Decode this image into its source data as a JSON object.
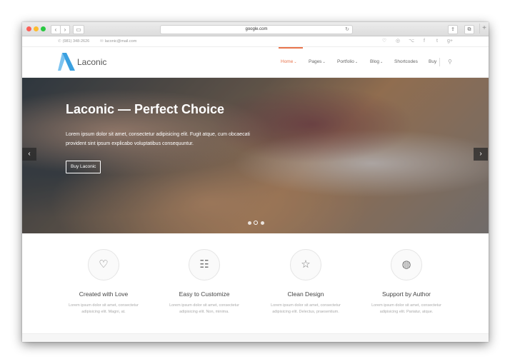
{
  "browser": {
    "url": "google.com",
    "reload_glyph": "↻",
    "back_glyph": "‹",
    "forward_glyph": "›",
    "sidebar_glyph": "▭",
    "share_glyph": "⇪",
    "tabs_glyph": "⧉",
    "new_tab_glyph": "+"
  },
  "topbar": {
    "phone": "(981) 348-2626",
    "email": "laconic@mail.com",
    "phone_icon": "✆",
    "email_icon": "✉",
    "social": [
      "♡",
      "◎",
      "⌥",
      "f",
      "t",
      "g+"
    ]
  },
  "header": {
    "logo_text": "Laconic",
    "menu": [
      "Home",
      "Pages",
      "Portfolio",
      "Blog",
      "Shortcodes",
      "Buy"
    ],
    "chevron": "⌄",
    "search_glyph": "⚲",
    "accent_color": "#e8744c"
  },
  "hero": {
    "title": "Laconic — Perfect Choice",
    "text": "Lorem ipsum dolor sit amet, consectetur adipisicing elit. Fugit atque, cum obcaecati provident sint ipsum explicabo voluptatibus consequuntur.",
    "button": "Buy Laconic",
    "prev_glyph": "‹",
    "next_glyph": "›",
    "slides_total": 3,
    "slide_active": 2
  },
  "features": [
    {
      "title": "Created with Love",
      "text": "Lorem ipsum dolor sit amet, consectetur adipisicing elit. Magni, at.",
      "icon": "♡"
    },
    {
      "title": "Easy to Customize",
      "text": "Lorem ipsum dolor sit amet, consectetur adipisicing elit. Non, minima.",
      "icon": "☷"
    },
    {
      "title": "Clean Design",
      "text": "Lorem ipsum dolor sit amet, consectetur adipisicing elit. Delectus, praesentium.",
      "icon": "☆"
    },
    {
      "title": "Support by Author",
      "text": "Lorem ipsum dolor sit amet, consectetur adipisicing elit. Pariatur, atque.",
      "icon": "◍"
    }
  ]
}
